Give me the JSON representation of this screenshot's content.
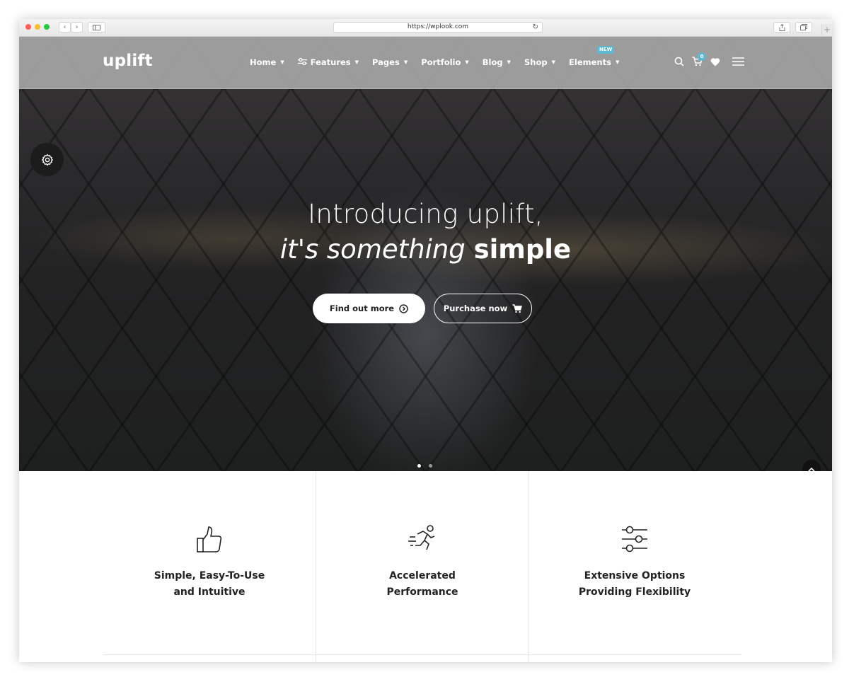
{
  "browser": {
    "url": "https://wplook.com",
    "reload_icon": "reload-icon"
  },
  "nav": {
    "logo": "uplift",
    "items": [
      {
        "label": "Home"
      },
      {
        "label": "Features",
        "icon": "sliders-icon"
      },
      {
        "label": "Pages"
      },
      {
        "label": "Portfolio"
      },
      {
        "label": "Blog"
      },
      {
        "label": "Shop"
      },
      {
        "label": "Elements",
        "badge": "NEW"
      }
    ],
    "cart_count": "0"
  },
  "hero": {
    "line1": "Introducing uplift,",
    "line2_light": "it's something",
    "line2_bold": "simple",
    "primary_button": "Find out more",
    "secondary_button": "Purchase now",
    "slides_total": 2,
    "active_slide": 1
  },
  "features": [
    {
      "icon": "thumbs-up-icon",
      "line1": "Simple, Easy-To-Use",
      "line2": "and Intuitive"
    },
    {
      "icon": "running-man-icon",
      "line1": "Accelerated",
      "line2": "Performance"
    },
    {
      "icon": "sliders-icon",
      "line1": "Extensive Options",
      "line2": "Providing Flexibility"
    }
  ],
  "colors": {
    "accent": "#5fb8d0",
    "nav_bg": "#a5a5a5",
    "hero_dark": "#232324"
  }
}
